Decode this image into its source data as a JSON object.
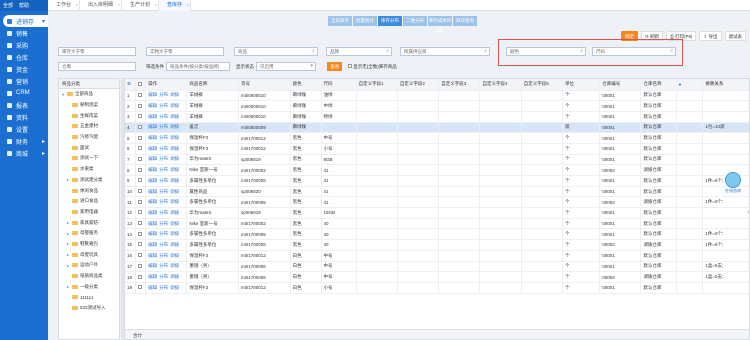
{
  "sidebar": {
    "top": [
      "全部",
      "帮助"
    ],
    "items": [
      {
        "label": "进销存",
        "active": true,
        "caret": "▾"
      },
      {
        "label": "销售"
      },
      {
        "label": "采购"
      },
      {
        "label": "仓库"
      },
      {
        "label": "资金"
      },
      {
        "label": "营销"
      },
      {
        "label": "CRM"
      },
      {
        "label": "报表"
      },
      {
        "label": "资料"
      },
      {
        "label": "设置"
      },
      {
        "label": "财务",
        "caret": "▸"
      },
      {
        "label": "商城",
        "caret": "▸"
      }
    ]
  },
  "top_tabs": [
    {
      "label": "工作台"
    },
    {
      "label": "出入库明细"
    },
    {
      "label": "生产计划"
    },
    {
      "label": "查库存",
      "active": true
    }
  ],
  "sub_tabs": [
    {
      "label": "当前库存"
    },
    {
      "label": "批量统计"
    },
    {
      "label": "库存分布",
      "active": true
    },
    {
      "label": "二维分布"
    },
    {
      "label": "库存成本时间"
    },
    {
      "label": "缺货查询"
    }
  ],
  "toolbar": {
    "orange": "确定",
    "refresh": "刷新",
    "print": "打印(P8)",
    "export": "导出",
    "custom": "调试表"
  },
  "filters": {
    "f1": "库存大于零",
    "f2": "实物大于零",
    "f3": "商品",
    "f4": "品牌",
    "f5": "所属供应商",
    "f6": "颜色",
    "f7": "尺码",
    "f8": "仓库",
    "f9_label": "筛选条件",
    "f9": "商品条件(按分类/按品牌)",
    "f10_label": "显示状态",
    "f10": "仅启用",
    "query": "查询",
    "show_all": "显示无(全数)库存商品"
  },
  "tree": {
    "header": "商品分类",
    "nodes": [
      {
        "label": "全部商品",
        "caret": "▾",
        "indent": 0
      },
      {
        "label": "秘制烧菜",
        "indent": 1
      },
      {
        "label": "生鲜肉菜",
        "indent": 1
      },
      {
        "label": "五金建材",
        "indent": 1
      },
      {
        "label": "汽修汽配",
        "indent": 1
      },
      {
        "label": "面试",
        "indent": 1
      },
      {
        "label": "测试一下",
        "indent": 1
      },
      {
        "label": "水果类",
        "indent": 1
      },
      {
        "label": "测试建分类",
        "caret": "▸",
        "indent": 1
      },
      {
        "label": "休闲食品",
        "indent": 1
      },
      {
        "label": "进口食品",
        "indent": 1
      },
      {
        "label": "家用电器",
        "indent": 1
      },
      {
        "label": "家具家纺",
        "caret": "▸",
        "indent": 1
      },
      {
        "label": "母婴服务",
        "caret": "▸",
        "indent": 1
      },
      {
        "label": "鞋靴箱包",
        "caret": "▸",
        "indent": 1
      },
      {
        "label": "母婴玩具",
        "caret": "▸",
        "indent": 1
      },
      {
        "label": "运动户外",
        "caret": "▸",
        "indent": 1
      },
      {
        "label": "纸质商品类",
        "indent": 1
      },
      {
        "label": "一级分类",
        "caret": "▸",
        "indent": 1
      },
      {
        "label": "111111",
        "indent": 1
      },
      {
        "label": "533测试导入",
        "indent": 1
      }
    ]
  },
  "grid": {
    "columns": [
      "",
      "",
      "操作",
      "商品名称",
      "货号",
      "颜色",
      "尺码",
      "自定义字段1",
      "自定义字段2",
      "自定义字段3",
      "自定义字段4",
      "自定义字段5",
      "单位",
      "仓库编号",
      "仓库名称",
      "",
      "换算关系"
    ],
    "op_labels": [
      "编辑",
      "分布",
      "调拨"
    ],
    "rows": [
      {
        "n": "1",
        "name": "羊绒裤",
        "code": "mi00500010",
        "color": "麻绿咖",
        "size": "油绿",
        "unit": "个",
        "wh_no": "00001",
        "wh": "默认仓库",
        "conv": ""
      },
      {
        "n": "2",
        "name": "羊绒裤",
        "code": "mi00500010",
        "color": "麻绿咖",
        "size": "中绿",
        "unit": "个",
        "wh_no": "00001",
        "wh": "默认仓库",
        "conv": ""
      },
      {
        "n": "3",
        "name": "羊绒裤",
        "code": "mi00500010",
        "color": "麻绿咖",
        "size": "特绿",
        "unit": "个",
        "wh_no": "00001",
        "wh": "默认仓库",
        "conv": ""
      },
      {
        "n": "4",
        "name": "羞涩",
        "code": "mi00500009",
        "color": "麻绿咖",
        "size": "",
        "unit": "袋",
        "wh_no": "00001",
        "wh": "默认仓库",
        "conv": "1包=10袋",
        "sel": true
      },
      {
        "n": "5",
        "name": "保温杯F3",
        "code": "mi01700012",
        "color": "黑色",
        "size": "中号",
        "unit": "个",
        "wh_no": "00001",
        "wh": "默认仓库",
        "conv": ""
      },
      {
        "n": "6",
        "name": "保温杯F3",
        "code": "mi01700012",
        "color": "黑色",
        "size": "小号",
        "unit": "个",
        "wh_no": "00001",
        "wh": "默认仓库",
        "conv": ""
      },
      {
        "n": "7",
        "name": "华为mateX",
        "code": "sp006519",
        "color": "黑色",
        "size": "8GB",
        "unit": "个",
        "wh_no": "00001",
        "wh": "默认仓库",
        "conv": ""
      },
      {
        "n": "8",
        "name": "Nike 室斯一号",
        "code": "mi01700002",
        "color": "黑色",
        "size": "41",
        "unit": "个",
        "wh_no": "00002",
        "wh": "调拨仓库",
        "conv": ""
      },
      {
        "n": "9",
        "name": "多属性多单位",
        "code": "mi01700005",
        "color": "黑色",
        "size": "41",
        "unit": "个",
        "wh_no": "00001",
        "wh": "默认仓库",
        "conv": "1件=6个;"
      },
      {
        "n": "10",
        "name": "属性商品",
        "code": "sp006520",
        "color": "黑色",
        "size": "41",
        "unit": "个",
        "wh_no": "00001",
        "wh": "默认仓库",
        "conv": ""
      },
      {
        "n": "11",
        "name": "多属性多单位",
        "code": "mi01700005",
        "color": "黑色",
        "size": "41",
        "unit": "个",
        "wh_no": "00002",
        "wh": "调拨仓库",
        "conv": "1件=6个;"
      },
      {
        "n": "12",
        "name": "华为mateX",
        "code": "sp006519",
        "color": "黑色",
        "size": "16GB",
        "unit": "个",
        "wh_no": "00001",
        "wh": "默认仓库",
        "conv": ""
      },
      {
        "n": "13",
        "name": "Nike 室斯一号",
        "code": "mi01700002",
        "color": "黑色",
        "size": "40",
        "unit": "个",
        "wh_no": "00001",
        "wh": "默认仓库",
        "conv": ""
      },
      {
        "n": "14",
        "name": "多属性多单位",
        "code": "mi01700005",
        "color": "黑色",
        "size": "40",
        "unit": "个",
        "wh_no": "00001",
        "wh": "默认仓库",
        "conv": "1件=6个;"
      },
      {
        "n": "15",
        "name": "多属性多单位",
        "code": "mi01700005",
        "color": "黑色",
        "size": "40",
        "unit": "个",
        "wh_no": "00002",
        "wh": "调拨仓库",
        "conv": "1件=6个;"
      },
      {
        "n": "16",
        "name": "保温杯F3",
        "code": "mi01700012",
        "color": "白色",
        "size": "中号",
        "unit": "个",
        "wh_no": "00001",
        "wh": "默认仓库",
        "conv": ""
      },
      {
        "n": "17",
        "name": "墨镜（男）",
        "code": "mi01700006",
        "color": "白色",
        "size": "中号",
        "unit": "个",
        "wh_no": "00001",
        "wh": "默认仓库",
        "conv": "1盒=5支;"
      },
      {
        "n": "18",
        "name": "墨镜（男）",
        "code": "mi01700006",
        "color": "白色",
        "size": "中号",
        "unit": "个",
        "wh_no": "00002",
        "wh": "调拨仓库",
        "conv": "1盒=5支;"
      },
      {
        "n": "19",
        "name": "保温杯F3",
        "code": "mi01700012",
        "color": "白色",
        "size": "小号",
        "unit": "个",
        "wh_no": "00001",
        "wh": "默认仓库",
        "conv": ""
      }
    ],
    "total_label": "合计"
  },
  "float_label": "在线咨询",
  "colors": {
    "primary": "#1b6fd0",
    "accent": "#f5871f",
    "highlight": "#d9534f"
  }
}
